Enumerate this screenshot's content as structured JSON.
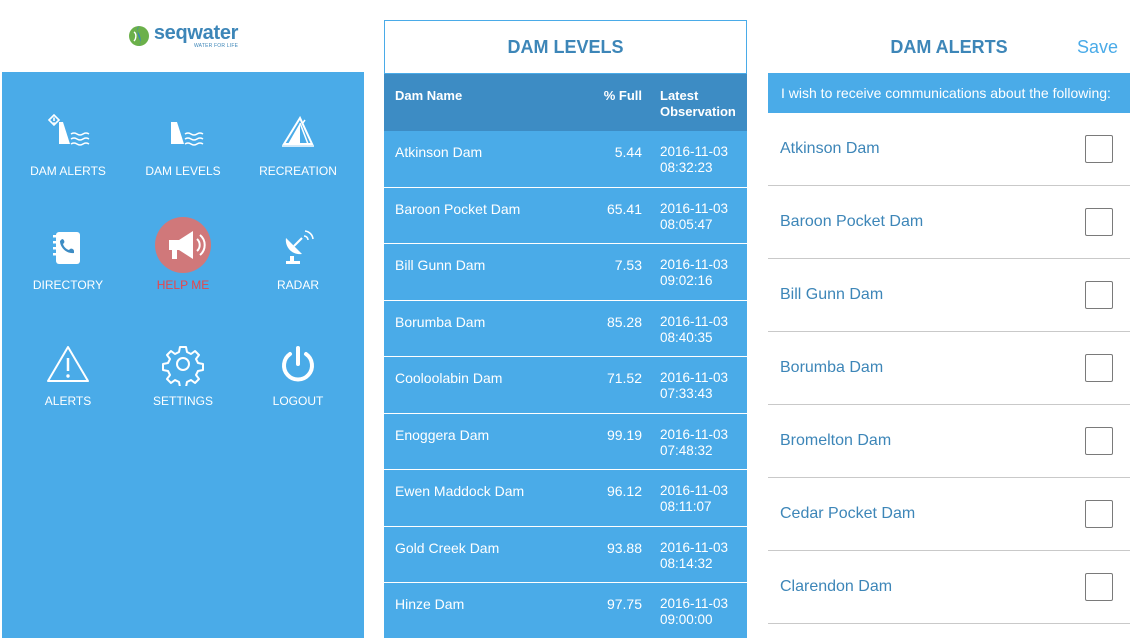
{
  "home": {
    "logo": {
      "word": "seqwater",
      "tagline": "WATER FOR LIFE"
    },
    "tiles": [
      {
        "label": "DAM ALERTS",
        "icon": "dam-alert-icon"
      },
      {
        "label": "DAM LEVELS",
        "icon": "dam-level-icon"
      },
      {
        "label": "RECREATION",
        "icon": "recreation-icon"
      },
      {
        "label": "DIRECTORY",
        "icon": "directory-phone-icon"
      },
      {
        "label": "HELP ME",
        "icon": "megaphone-icon"
      },
      {
        "label": "RADAR",
        "icon": "radar-dish-icon"
      },
      {
        "label": "ALERTS",
        "icon": "warning-triangle-icon"
      },
      {
        "label": "SETTINGS",
        "icon": "gear-icon"
      },
      {
        "label": "LOGOUT",
        "icon": "power-icon"
      }
    ],
    "colors": {
      "background": "#4aabe8",
      "help_label": "#e8454a",
      "help_circle": "#d0787a"
    }
  },
  "levels": {
    "title": "DAM LEVELS",
    "columns": {
      "name": "Dam Name",
      "pct": "% Full",
      "obs": "Latest Observation"
    },
    "rows": [
      {
        "name": "Atkinson Dam",
        "pct": "5.44",
        "date": "2016-11-03",
        "time": "08:32:23"
      },
      {
        "name": "Baroon Pocket Dam",
        "pct": "65.41",
        "date": "2016-11-03",
        "time": "08:05:47"
      },
      {
        "name": "Bill Gunn Dam",
        "pct": "7.53",
        "date": "2016-11-03",
        "time": "09:02:16"
      },
      {
        "name": "Borumba Dam",
        "pct": "85.28",
        "date": "2016-11-03",
        "time": "08:40:35"
      },
      {
        "name": "Cooloolabin Dam",
        "pct": "71.52",
        "date": "2016-11-03",
        "time": "07:33:43"
      },
      {
        "name": "Enoggera Dam",
        "pct": "99.19",
        "date": "2016-11-03",
        "time": "07:48:32"
      },
      {
        "name": "Ewen Maddock Dam",
        "pct": "96.12",
        "date": "2016-11-03",
        "time": "08:11:07"
      },
      {
        "name": "Gold Creek Dam",
        "pct": "93.88",
        "date": "2016-11-03",
        "time": "08:14:32"
      },
      {
        "name": "Hinze Dam",
        "pct": "97.75",
        "date": "2016-11-03",
        "time": "09:00:00"
      }
    ]
  },
  "alerts": {
    "title": "DAM ALERTS",
    "save_label": "Save",
    "intro": "I wish to receive communications about the following:",
    "dams": [
      {
        "name": "Atkinson Dam",
        "checked": false
      },
      {
        "name": "Baroon Pocket Dam",
        "checked": false
      },
      {
        "name": "Bill Gunn Dam",
        "checked": false
      },
      {
        "name": "Borumba Dam",
        "checked": false
      },
      {
        "name": "Bromelton Dam",
        "checked": false
      },
      {
        "name": "Cedar Pocket Dam",
        "checked": false
      },
      {
        "name": "Clarendon Dam",
        "checked": false
      }
    ]
  }
}
